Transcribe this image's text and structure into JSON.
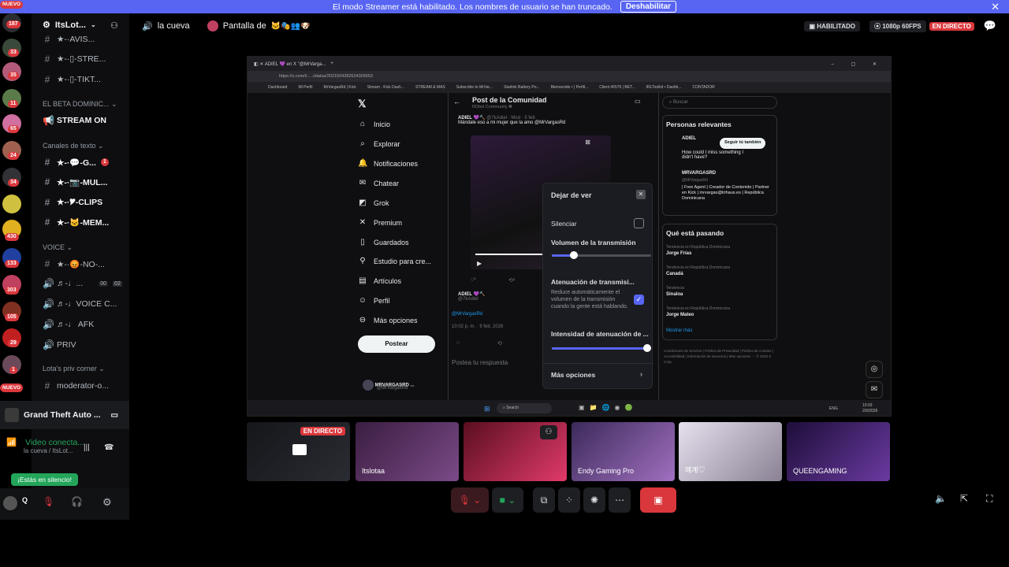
{
  "banner": {
    "text": "El modo Streamer está habilitado. Los nombres de usuario se han truncado.",
    "button": "Deshabilitar"
  },
  "rail": {
    "badges": [
      "NUEVO",
      "187",
      "33",
      "35",
      "11",
      "65",
      "24",
      "34",
      "430",
      "133",
      "303",
      "105",
      "29",
      "1",
      "NUEVO"
    ]
  },
  "server": {
    "name": "ItsLot...",
    "channels_top": [
      "★-·AVIS...",
      "★-·▯-STRE...",
      "★-·▯-TIKT..."
    ],
    "cat_beta": "EL BETA DOMINIC...",
    "stream_on": "STREAM ON",
    "cat_text": "Canales de texto",
    "text_channels": [
      {
        "label": "★-·💬-G...",
        "badge": "1"
      },
      {
        "label": "★-·📷-MUL..."
      },
      {
        "label": "★-·🎔-CLIPS"
      },
      {
        "label": "★-·🐱-MEM..."
      }
    ],
    "cat_voice": "VOICE",
    "voice_channels": [
      {
        "label": "★-·😡-NO-..."
      },
      {
        "label": "♬-♩...",
        "count_a": "00",
        "count_b": "02"
      },
      {
        "label": "♬-♩VOICE C..."
      },
      {
        "label": "♬-♩ AFK"
      },
      {
        "label": "PRIV"
      }
    ],
    "cat_priv": "Lota's priv corner",
    "mod": "moderator-o...",
    "game": "Grand Theft Auto ..."
  },
  "voice_status": {
    "title": "Video conecta...",
    "sub": "la cueva / ItsLot...",
    "toast": "¡Estás en silencio!"
  },
  "topbar": {
    "channel": "la cueva",
    "screen": "Pantalla de",
    "habilitado": "HABILITADO",
    "quality": "1080p 60FPS",
    "live": "EN DIRECTO"
  },
  "browser": {
    "url": "https://x.com/i/...../status/2021504282624305653",
    "bookmarks": [
      "Dashboard",
      "Mi Perfil",
      "MrVargasRd | Kick",
      "Stream · Kick Dash...",
      "STREAM & MAS",
      "Subscribe to MrVar...",
      "Starlink Battery Po...",
      "Bienvenido • | Perfil...",
      "Client #6576 | BET...",
      "IRLToolkit • Dashb...",
      "CONTADOR"
    ],
    "nav": [
      "Inicio",
      "Explorar",
      "Notificaciones",
      "Chatear",
      "Grok",
      "Premium",
      "Guardados",
      "Estudio para cre...",
      "Artículos",
      "Perfil",
      "Más opciones"
    ],
    "post_btn": "Postear",
    "feed_title": "Post de la Comunidad",
    "feed_sub": "RDbol Community ✖",
    "tweet_user": "ADIEL",
    "tweet_handle": "@7kAdiel · Mod · 5 feb",
    "tweet_text": "Mándale eso a mi mujer que la amo @MrVargasRd",
    "reply_user": "ADIEL",
    "reply_handle": "@7kAdiel",
    "reply_mention": "@MrVargasRd",
    "timestamp": "10:02 p. m. · 9 feb. 2026",
    "reply_placeholder": "Postea tu respuesta",
    "account_name": "MRVARGASRD ...",
    "account_handle": "@MrVargasRd",
    "search_placeholder": "Buscar",
    "relevant_title": "Personas relevantes",
    "follow_btn": "Seguir tú también",
    "rel1_name": "ADIEL",
    "rel1_text": "How could I miss something I didn't have?",
    "rel2_name": "MRVARGASRD",
    "rel2_handle": "@MrVargasRd",
    "rel2_bio": "| Free Agent | Creador de Contenido | Partner en Kick | mrvargas@trihaus.es | República Dominicana",
    "trends_title": "Qué está pasando",
    "trends": [
      {
        "ctx": "Tendencia en República Dominicana",
        "name": "Jorge Frías"
      },
      {
        "ctx": "Tendencia en República Dominicana",
        "name": "Canadá"
      },
      {
        "ctx": "Tendencia",
        "name": "Sinaloa"
      },
      {
        "ctx": "Tendencia en República Dominicana",
        "name": "Jorge Mateo"
      }
    ],
    "show_more": "Mostrar más",
    "footer": "Condiciones de Servicio | Política de Privacidad | Política de cookies | Accesibilidad | Información de anuncios | Más opciones ··· © 2026 X Corp.",
    "taskbar_search": "Search",
    "taskbar_lang": "ENG",
    "taskbar_time": "10:03",
    "taskbar_date": "2/9/2026"
  },
  "popup": {
    "title": "Dejar de ver",
    "mute": "Silenciar",
    "volume_label": "Volumen de la transmisión",
    "volume": 0.22,
    "atten_label": "Atenuación de transmisi...",
    "atten_desc": "Reduce automáticamente el volumen de la transmisión cuando la gente está hablando.",
    "intensity_label": "Intensidad de atenuación de ...",
    "intensity": 1.0,
    "more": "Más opciones"
  },
  "tiles": [
    {
      "name": "",
      "live": "EN DIRECTO"
    },
    {
      "name": "Itslotaa"
    },
    {
      "name": ""
    },
    {
      "name": "Endy Gaming Pro"
    },
    {
      "name": "예계♡"
    },
    {
      "name": "QUEENGAMING"
    }
  ],
  "colors": {
    "accent": "#5865f2",
    "live": "#da373c",
    "green": "#23a55a"
  }
}
